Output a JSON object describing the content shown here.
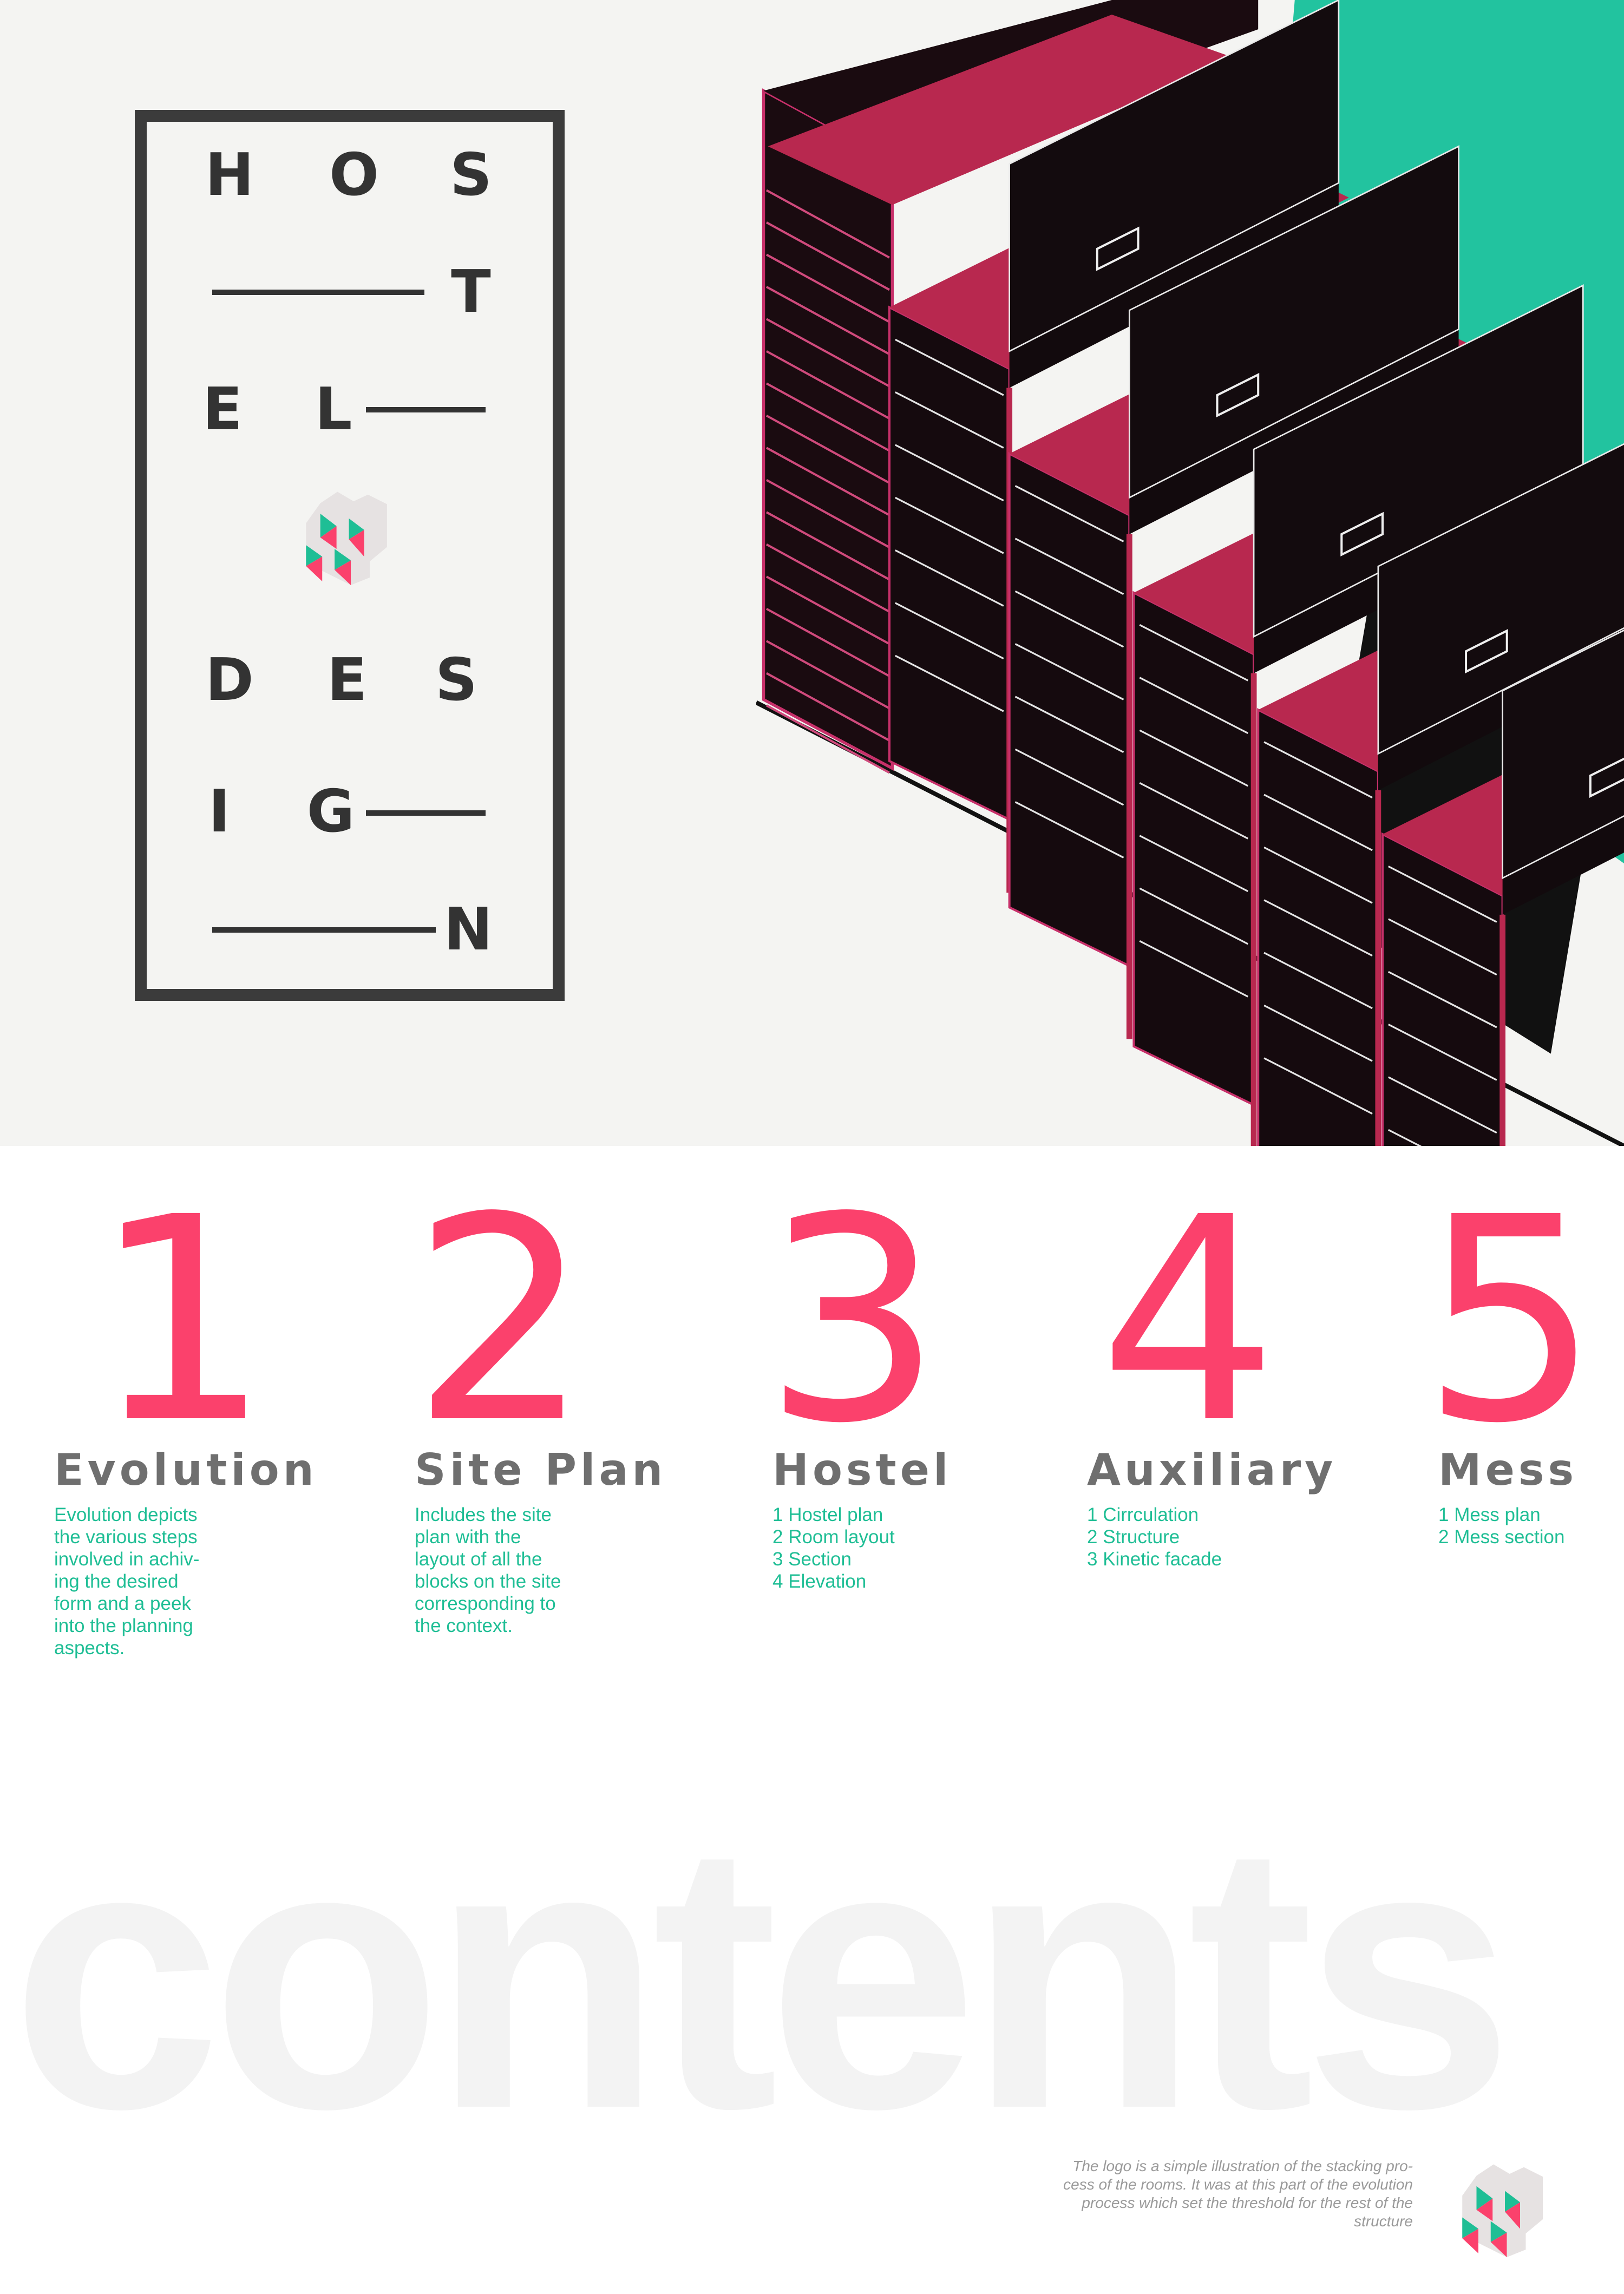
{
  "title": {
    "letters": [
      "H",
      "O",
      "S",
      "T",
      "E",
      "L",
      "D",
      "E",
      "S",
      "I",
      "G",
      "N"
    ]
  },
  "colors": {
    "accent_pink": "#fb416c",
    "accent_teal": "#1fbe95",
    "heading_gray": "#6f6f6f",
    "dark": "#333333",
    "building_magenta": "#b8284f"
  },
  "sections": [
    {
      "number": "1",
      "heading": "Evolution",
      "lines": [
        "Evolution depicts",
        "the various steps",
        "involved in achiv-",
        "ing the desired",
        "form and a peek",
        "into the planning",
        "aspects."
      ]
    },
    {
      "number": "2",
      "heading": "Site Plan",
      "lines": [
        "Includes the site",
        "plan with the",
        "layout of all the",
        "blocks on the site",
        "corresponding to",
        "the context."
      ]
    },
    {
      "number": "3",
      "heading": "Hostel",
      "lines": [
        "1 Hostel plan",
        "2 Room layout",
        "3 Section",
        "4 Elevation"
      ]
    },
    {
      "number": "4",
      "heading": "Auxiliary",
      "lines": [
        "1 Cirrculation",
        "2 Structure",
        "3 Kinetic facade"
      ]
    },
    {
      "number": "5",
      "heading": "Mess",
      "lines": [
        "1 Mess plan",
        "2 Mess section"
      ]
    }
  ],
  "background_word": "contents",
  "caption": {
    "lines": [
      "The logo is a simple illustration of the stacking pro-",
      "cess of the rooms. It was at this part of the evolution",
      "process which set the threshold for the rest of the",
      "structure"
    ]
  }
}
